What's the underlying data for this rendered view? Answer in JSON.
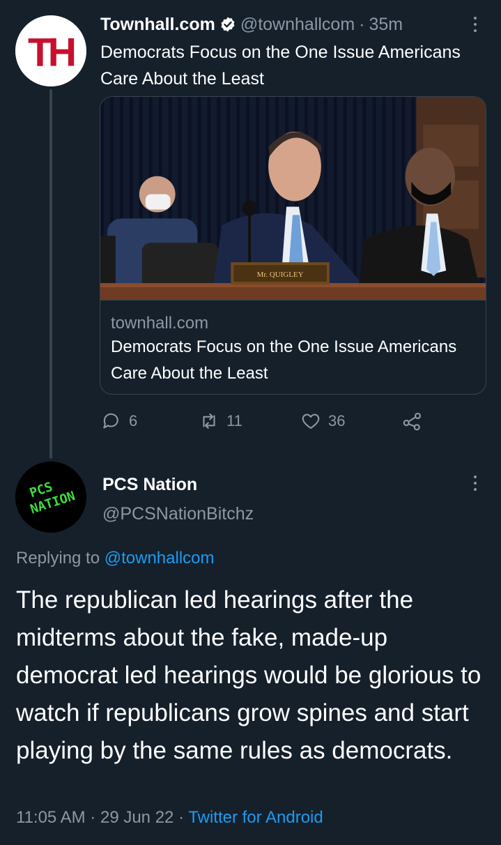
{
  "colors": {
    "background": "#15202b",
    "secondary_text": "#8b98a5",
    "link": "#1d9bf0",
    "border": "#38444d",
    "verified_badge": "#ffffff"
  },
  "parent_tweet": {
    "avatar_icon": "townhall-logo",
    "avatar_logo_text": "TH",
    "display_name": "Townhall.com",
    "verified_icon": "verified-badge-icon",
    "handle": "@townhallcom",
    "separator": "·",
    "time_ago": "35m",
    "text": "Democrats Focus on the One Issue Americans Care About the Least",
    "link_card": {
      "image_icon": "congressional-hearing-photo",
      "nameplate_text": "Mr. QUIGLEY",
      "domain": "townhall.com",
      "title": "Democrats Focus on the One Issue Americans Care About the Least"
    },
    "actions": {
      "reply_count": "6",
      "retweet_count": "11",
      "like_count": "36"
    }
  },
  "reply_tweet": {
    "avatar_icon": "pcs-nation-logo",
    "avatar_logo_line1": "PCS",
    "avatar_logo_line2": "NATION",
    "display_name": "PCS Nation",
    "handle": "@PCSNationBitchz",
    "replying_prefix": "Replying to",
    "replying_handle": "@townhallcom",
    "text": "The republican led hearings after the midterms about the fake, made-up democrat led hearings would be glorious to watch if republicans grow spines and start playing by the same rules as democrats.",
    "time": "11:05 AM",
    "date": "29 Jun 22",
    "separator": "·",
    "source": "Twitter for Android"
  }
}
